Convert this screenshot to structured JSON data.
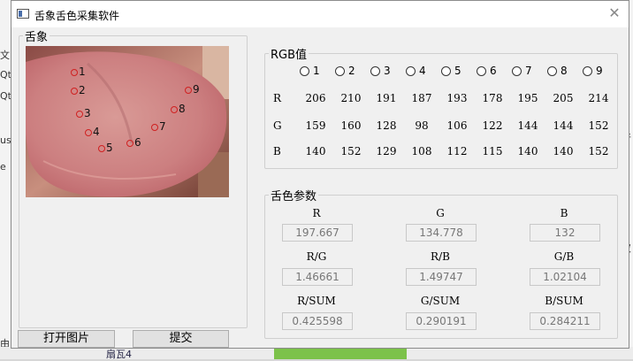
{
  "window": {
    "title": "舌象舌色采集软件",
    "close_glyph": "✕"
  },
  "background": {
    "left_fragments": [
      "文",
      "Qt",
      "Qt",
      "us",
      "e",
      "由"
    ],
    "right_fragments": [
      "件",
      "皮"
    ],
    "taskbar_item": "扇瓦4"
  },
  "tongue_group": {
    "legend": "舌象",
    "points": [
      "1",
      "2",
      "3",
      "4",
      "5",
      "6",
      "7",
      "8",
      "9"
    ]
  },
  "buttons": {
    "open": "打开图片",
    "submit": "提交"
  },
  "rgb_group": {
    "legend": "RGB值",
    "radio_labels": [
      "1",
      "2",
      "3",
      "4",
      "5",
      "6",
      "7",
      "8",
      "9"
    ],
    "rows": [
      {
        "label": "R",
        "values": [
          "206",
          "210",
          "191",
          "187",
          "193",
          "178",
          "195",
          "205",
          "214"
        ]
      },
      {
        "label": "G",
        "values": [
          "159",
          "160",
          "128",
          "98",
          "106",
          "122",
          "144",
          "144",
          "152"
        ]
      },
      {
        "label": "B",
        "values": [
          "140",
          "152",
          "129",
          "108",
          "112",
          "115",
          "140",
          "140",
          "152"
        ]
      }
    ]
  },
  "params_group": {
    "legend": "舌色参数",
    "items": [
      {
        "label": "R",
        "value": "197.667"
      },
      {
        "label": "G",
        "value": "134.778"
      },
      {
        "label": "B",
        "value": "132"
      },
      {
        "label": "R/G",
        "value": "1.46661"
      },
      {
        "label": "R/B",
        "value": "1.49747"
      },
      {
        "label": "G/B",
        "value": "1.02104"
      },
      {
        "label": "R/SUM",
        "value": "0.425598"
      },
      {
        "label": "G/SUM",
        "value": "0.290191"
      },
      {
        "label": "B/SUM",
        "value": "0.284211"
      }
    ]
  }
}
